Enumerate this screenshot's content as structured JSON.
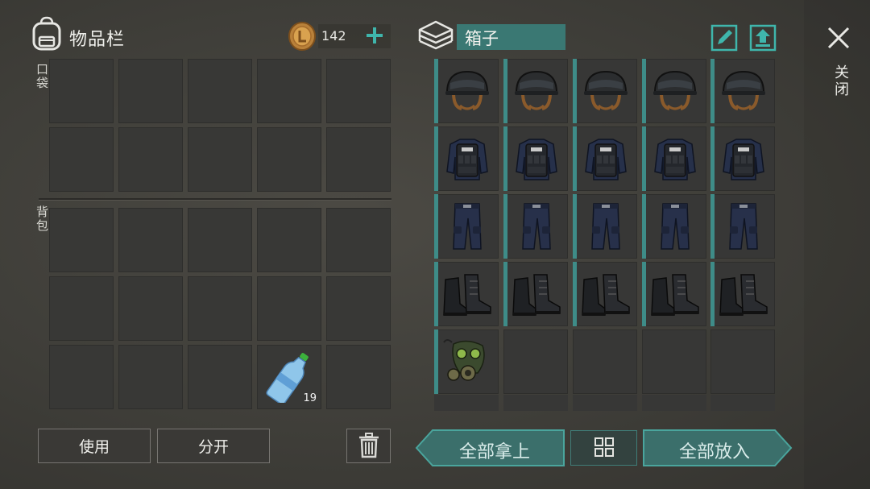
{
  "inventory": {
    "title": "物品栏",
    "coins": "142",
    "pocket_label": "口袋",
    "backpack_label": "背包",
    "backpack_items": [
      {
        "row": 2,
        "col": 3,
        "icon": "water-bottle-icon",
        "qty": "19"
      }
    ]
  },
  "box": {
    "name": "箱子",
    "items": [
      {
        "icon": "helmet-icon"
      },
      {
        "icon": "helmet-icon"
      },
      {
        "icon": "helmet-icon"
      },
      {
        "icon": "helmet-icon"
      },
      {
        "icon": "helmet-icon"
      },
      {
        "icon": "police-vest-icon"
      },
      {
        "icon": "police-vest-icon"
      },
      {
        "icon": "police-vest-icon"
      },
      {
        "icon": "police-vest-icon"
      },
      {
        "icon": "police-vest-icon"
      },
      {
        "icon": "pants-icon"
      },
      {
        "icon": "pants-icon"
      },
      {
        "icon": "pants-icon"
      },
      {
        "icon": "pants-icon"
      },
      {
        "icon": "pants-icon"
      },
      {
        "icon": "boots-icon"
      },
      {
        "icon": "boots-icon"
      },
      {
        "icon": "boots-icon"
      },
      {
        "icon": "boots-icon"
      },
      {
        "icon": "boots-icon"
      },
      {
        "icon": "gas-mask-icon"
      }
    ]
  },
  "close_label": "关闭",
  "buttons": {
    "use": "使用",
    "split": "分开",
    "take_all": "全部拿上",
    "put_all": "全部放入"
  },
  "colors": {
    "accent": "#3e8c88",
    "slot": "#383836",
    "background": "#44433e"
  }
}
